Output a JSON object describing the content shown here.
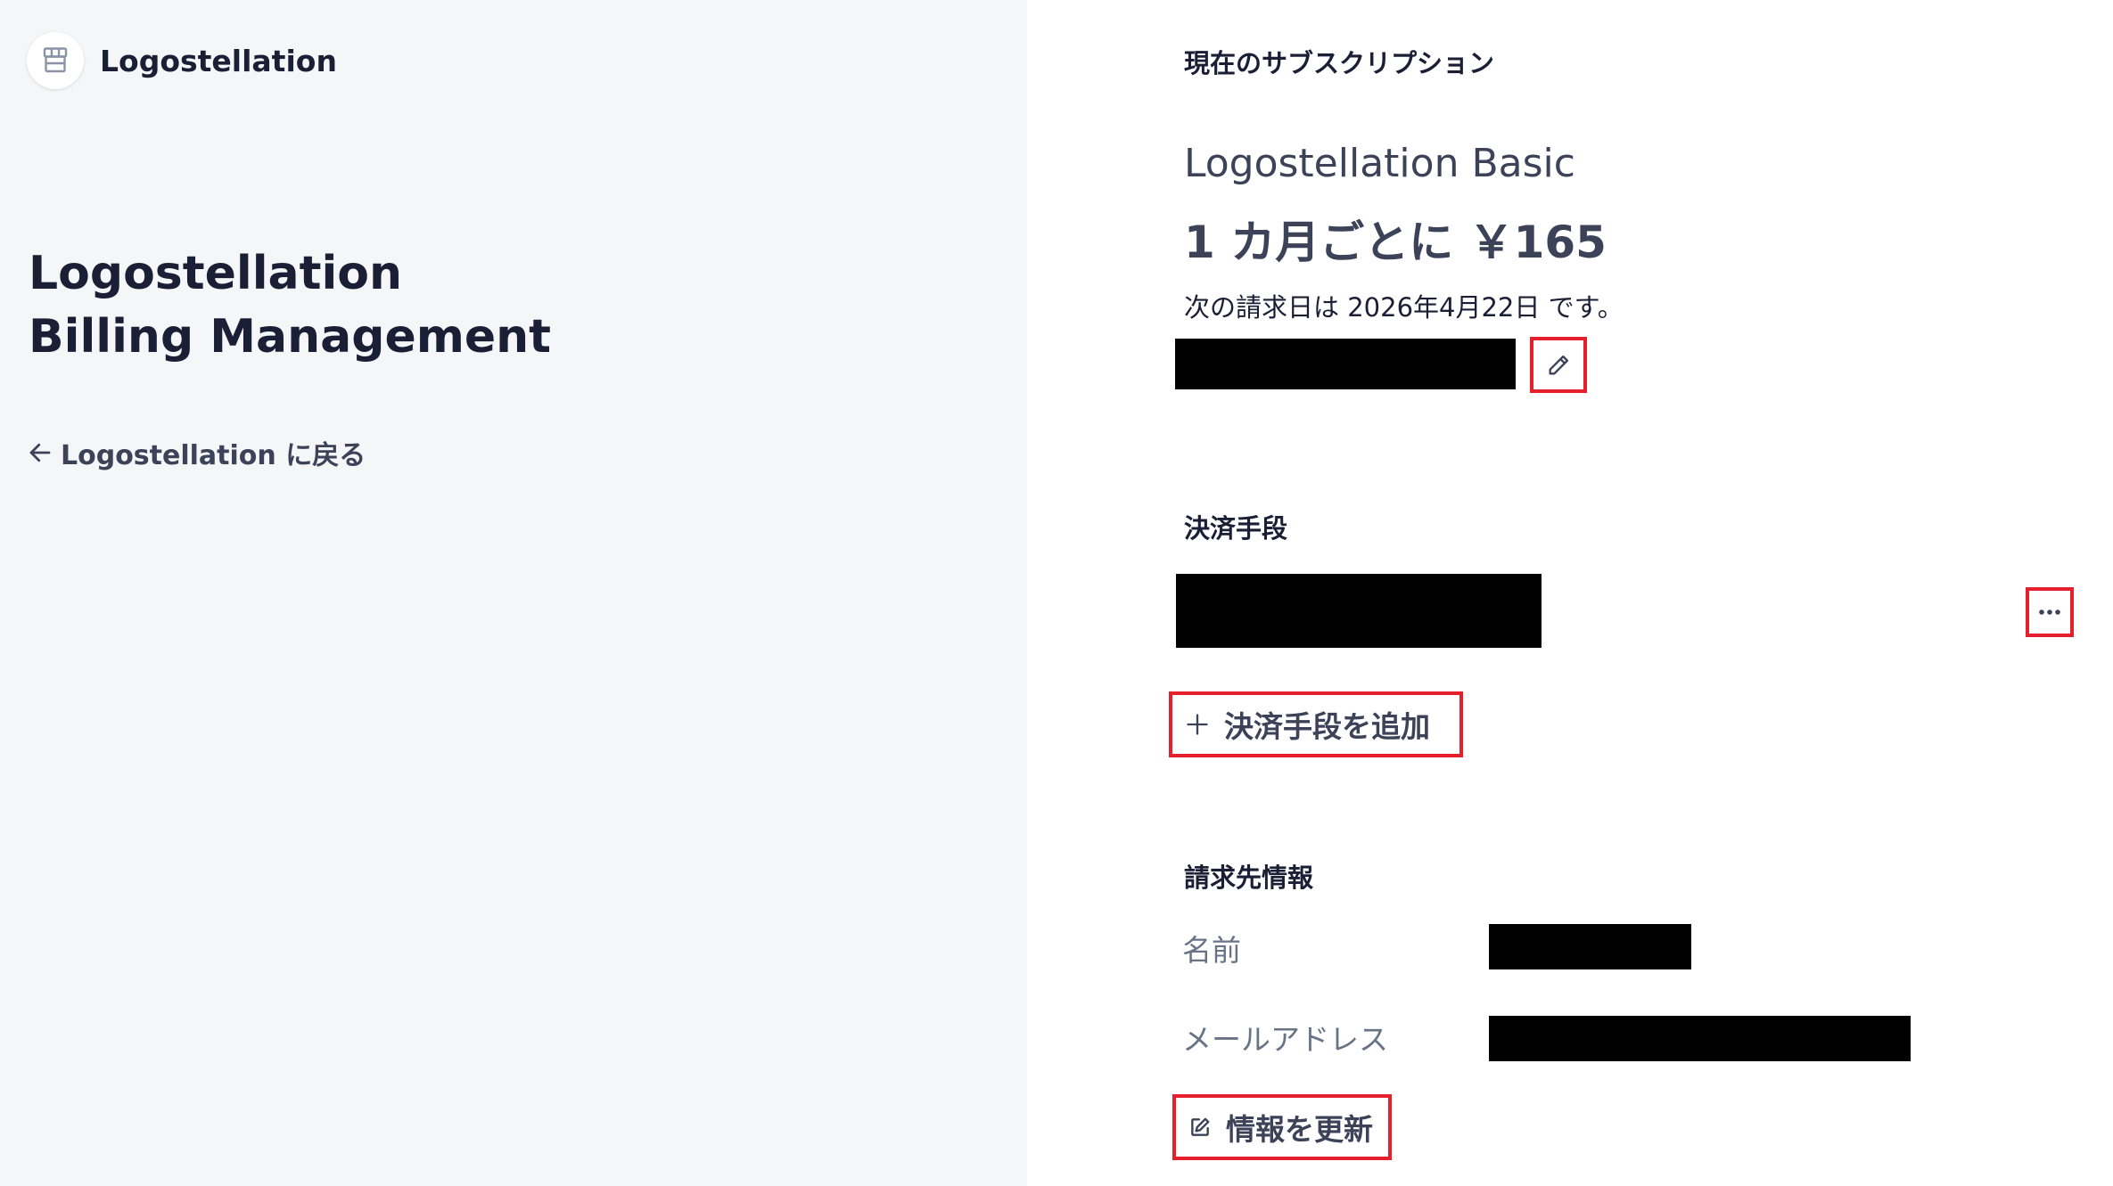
{
  "brand": {
    "name": "Logostellation",
    "logo_icon": "storefront-icon"
  },
  "left": {
    "title": "Logostellation Billing Management",
    "back_link": "Logostellation に戻る",
    "back_icon": "arrow-left-icon"
  },
  "subscription": {
    "heading": "現在のサブスクリプション",
    "plan_name": "Logostellation Basic",
    "price": "1 カ月ごとに ￥165",
    "next_billing": "次の請求日は 2026年4月22日 です。",
    "edit_icon": "pencil-icon"
  },
  "payment": {
    "heading": "決済手段",
    "more_icon": "more-horizontal-icon",
    "add_label": "決済手段を追加",
    "add_icon": "plus-icon"
  },
  "billing_info": {
    "heading": "請求先情報",
    "name_label": "名前",
    "email_label": "メールアドレス",
    "update_label": "情報を更新",
    "update_icon": "edit-square-icon"
  },
  "colors": {
    "left_background": "#f5f6f8",
    "text_primary": "#1a1f36",
    "text_secondary": "#3c4257",
    "label_muted": "#697386",
    "highlight_frame": "#e5202c"
  }
}
